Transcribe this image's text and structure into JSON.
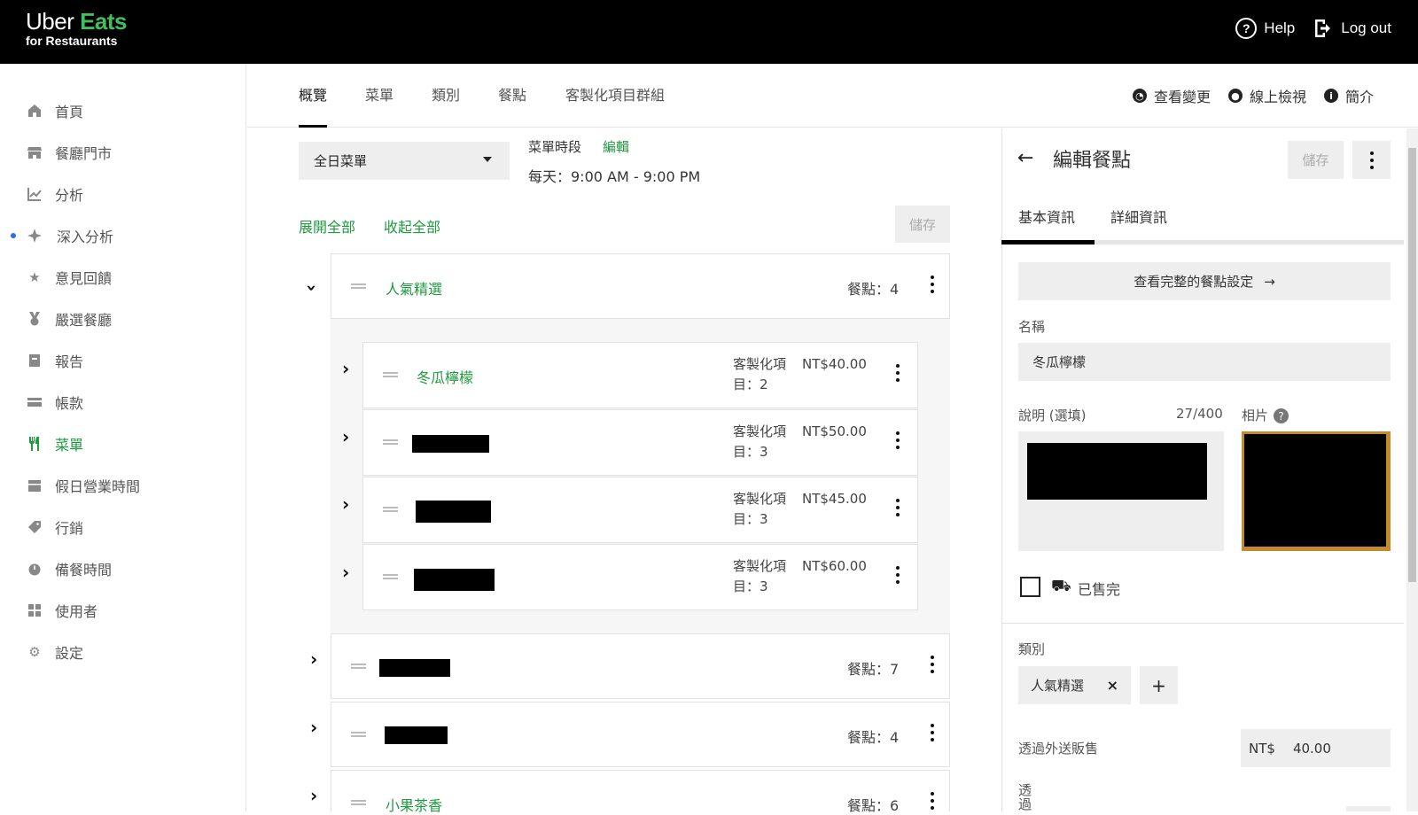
{
  "header": {
    "logo_uber": "Uber",
    "logo_eats": "Eats",
    "logo_sub": "for Restaurants",
    "help": "Help",
    "logout": "Log out"
  },
  "sidebar": {
    "items": [
      {
        "label": "首頁",
        "icon": "home-icon"
      },
      {
        "label": "餐廳門市",
        "icon": "store-icon"
      },
      {
        "label": "分析",
        "icon": "chart-icon"
      },
      {
        "label": "深入分析",
        "icon": "sparkle-icon"
      },
      {
        "label": "意見回饋",
        "icon": "star-icon"
      },
      {
        "label": "嚴選餐廳",
        "icon": "medal-icon"
      },
      {
        "label": "報告",
        "icon": "report-icon"
      },
      {
        "label": "帳款",
        "icon": "payment-icon"
      },
      {
        "label": "菜單",
        "icon": "utensils-icon"
      },
      {
        "label": "假日營業時間",
        "icon": "calendar-icon"
      },
      {
        "label": "行銷",
        "icon": "tag-icon"
      },
      {
        "label": "備餐時間",
        "icon": "timer-icon"
      },
      {
        "label": "使用者",
        "icon": "users-icon"
      },
      {
        "label": "設定",
        "icon": "gear-icon"
      }
    ],
    "active_color": "#1f9a3e"
  },
  "tabs": {
    "items": [
      "概覽",
      "菜單",
      "類別",
      "餐點",
      "客製化項目群組"
    ],
    "active": "概覽",
    "view_changes": "查看變更",
    "view_online": "線上檢視",
    "intro": "簡介"
  },
  "menu": {
    "selected": "全日菜單",
    "period_label": "菜單時段",
    "period_edit": "編輯",
    "period_time": "每天：9:00 AM - 9:00 PM",
    "expand_all": "展開全部",
    "collapse_all": "收起全部",
    "save": "儲存",
    "categories": [
      {
        "name": "人氣精選",
        "count": "餐點：4"
      },
      {
        "name": "",
        "count": "餐點：7"
      },
      {
        "name": "",
        "count": "餐點：4"
      },
      {
        "name": "小果茶香",
        "count": "餐點：6"
      }
    ],
    "items": [
      {
        "name": "冬瓜檸檬",
        "cust_a": "客製化項",
        "cust_b": "目：2",
        "price": "NT$40.00"
      },
      {
        "name": "",
        "cust_a": "客製化項",
        "cust_b": "目：3",
        "price": "NT$50.00"
      },
      {
        "name": "",
        "cust_a": "客製化項",
        "cust_b": "目：3",
        "price": "NT$45.00"
      },
      {
        "name": "",
        "cust_a": "客製化項",
        "cust_b": "目：3",
        "price": "NT$60.00"
      }
    ]
  },
  "panel": {
    "title": "編輯餐點",
    "save": "儲存",
    "tab_basic": "基本資訊",
    "tab_detail": "詳細資訊",
    "view_full": "查看完整的餐點設定",
    "name_label": "名稱",
    "name_value": "冬瓜檸檬",
    "desc_label": "說明 (選填)",
    "desc_count": "27/400",
    "photo_label": "相片",
    "sold_out": "已售完",
    "category_label": "類別",
    "category_chip": "人氣精選",
    "delivery_label": "透過外送販售",
    "currency": "NT$",
    "price": "40.00",
    "cut_label": "透\n過"
  }
}
